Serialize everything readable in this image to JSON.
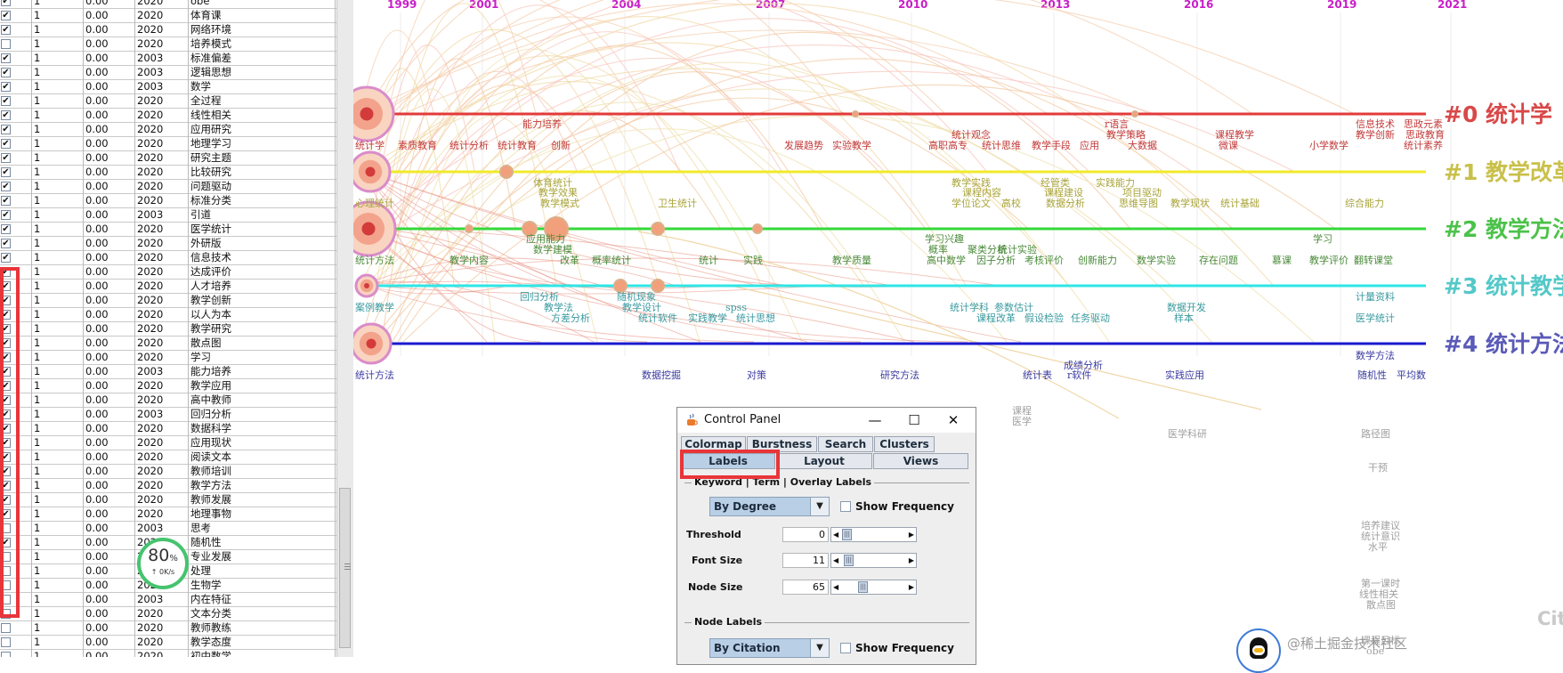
{
  "table": {
    "rows": [
      {
        "checked": true,
        "count": "1",
        "centrality": "0.00",
        "year": "2020",
        "keyword": "obe"
      },
      {
        "checked": true,
        "count": "1",
        "centrality": "0.00",
        "year": "2020",
        "keyword": "体育课"
      },
      {
        "checked": true,
        "count": "1",
        "centrality": "0.00",
        "year": "2020",
        "keyword": "网络环境"
      },
      {
        "checked": false,
        "count": "1",
        "centrality": "0.00",
        "year": "2020",
        "keyword": "培养模式"
      },
      {
        "checked": true,
        "count": "1",
        "centrality": "0.00",
        "year": "2003",
        "keyword": "标准偏差"
      },
      {
        "checked": true,
        "count": "1",
        "centrality": "0.00",
        "year": "2003",
        "keyword": "逻辑思想"
      },
      {
        "checked": true,
        "count": "1",
        "centrality": "0.00",
        "year": "2003",
        "keyword": "数学"
      },
      {
        "checked": true,
        "count": "1",
        "centrality": "0.00",
        "year": "2020",
        "keyword": "全过程"
      },
      {
        "checked": true,
        "count": "1",
        "centrality": "0.00",
        "year": "2020",
        "keyword": "线性相关"
      },
      {
        "checked": true,
        "count": "1",
        "centrality": "0.00",
        "year": "2020",
        "keyword": "应用研究"
      },
      {
        "checked": true,
        "count": "1",
        "centrality": "0.00",
        "year": "2020",
        "keyword": "地理学习"
      },
      {
        "checked": true,
        "count": "1",
        "centrality": "0.00",
        "year": "2020",
        "keyword": "研究主题"
      },
      {
        "checked": true,
        "count": "1",
        "centrality": "0.00",
        "year": "2020",
        "keyword": "比较研究"
      },
      {
        "checked": true,
        "count": "1",
        "centrality": "0.00",
        "year": "2020",
        "keyword": "问题驱动"
      },
      {
        "checked": true,
        "count": "1",
        "centrality": "0.00",
        "year": "2020",
        "keyword": "标准分类"
      },
      {
        "checked": true,
        "count": "1",
        "centrality": "0.00",
        "year": "2003",
        "keyword": "引道"
      },
      {
        "checked": true,
        "count": "1",
        "centrality": "0.00",
        "year": "2020",
        "keyword": "医学统计"
      },
      {
        "checked": true,
        "count": "1",
        "centrality": "0.00",
        "year": "2020",
        "keyword": "外研版"
      },
      {
        "checked": true,
        "count": "1",
        "centrality": "0.00",
        "year": "2020",
        "keyword": "信息技术"
      },
      {
        "checked": true,
        "count": "1",
        "centrality": "0.00",
        "year": "2020",
        "keyword": "达成评价"
      },
      {
        "checked": true,
        "count": "1",
        "centrality": "0.00",
        "year": "2020",
        "keyword": "人才培养"
      },
      {
        "checked": true,
        "count": "1",
        "centrality": "0.00",
        "year": "2020",
        "keyword": "教学创新"
      },
      {
        "checked": true,
        "count": "1",
        "centrality": "0.00",
        "year": "2020",
        "keyword": "以人为本"
      },
      {
        "checked": true,
        "count": "1",
        "centrality": "0.00",
        "year": "2020",
        "keyword": "教学研究"
      },
      {
        "checked": true,
        "count": "1",
        "centrality": "0.00",
        "year": "2020",
        "keyword": "散点图"
      },
      {
        "checked": true,
        "count": "1",
        "centrality": "0.00",
        "year": "2020",
        "keyword": "学习"
      },
      {
        "checked": true,
        "count": "1",
        "centrality": "0.00",
        "year": "2003",
        "keyword": "能力培养"
      },
      {
        "checked": true,
        "count": "1",
        "centrality": "0.00",
        "year": "2020",
        "keyword": "教学应用"
      },
      {
        "checked": true,
        "count": "1",
        "centrality": "0.00",
        "year": "2020",
        "keyword": "高中教师"
      },
      {
        "checked": true,
        "count": "1",
        "centrality": "0.00",
        "year": "2003",
        "keyword": "回归分析"
      },
      {
        "checked": true,
        "count": "1",
        "centrality": "0.00",
        "year": "2020",
        "keyword": "数据科学"
      },
      {
        "checked": true,
        "count": "1",
        "centrality": "0.00",
        "year": "2020",
        "keyword": "应用现状"
      },
      {
        "checked": true,
        "count": "1",
        "centrality": "0.00",
        "year": "2020",
        "keyword": "阅读文本"
      },
      {
        "checked": true,
        "count": "1",
        "centrality": "0.00",
        "year": "2020",
        "keyword": "教师培训"
      },
      {
        "checked": true,
        "count": "1",
        "centrality": "0.00",
        "year": "2020",
        "keyword": "教学方法"
      },
      {
        "checked": true,
        "count": "1",
        "centrality": "0.00",
        "year": "2020",
        "keyword": "教师发展"
      },
      {
        "checked": true,
        "count": "1",
        "centrality": "0.00",
        "year": "2020",
        "keyword": "地理事物"
      },
      {
        "checked": false,
        "count": "1",
        "centrality": "0.00",
        "year": "2003",
        "keyword": "思考"
      },
      {
        "checked": true,
        "count": "1",
        "centrality": "0.00",
        "year": "2020",
        "keyword": "随机性"
      },
      {
        "checked": false,
        "count": "1",
        "centrality": "0.00",
        "year": "2020",
        "keyword": "专业发展"
      },
      {
        "checked": false,
        "count": "1",
        "centrality": "0.00",
        "year": "2020",
        "keyword": "处理"
      },
      {
        "checked": false,
        "count": "1",
        "centrality": "0.00",
        "year": "2020",
        "keyword": "生物学"
      },
      {
        "checked": false,
        "count": "1",
        "centrality": "0.00",
        "year": "2003",
        "keyword": "内在特征"
      },
      {
        "checked": false,
        "count": "1",
        "centrality": "0.00",
        "year": "2020",
        "keyword": "文本分类"
      },
      {
        "checked": false,
        "count": "1",
        "centrality": "0.00",
        "year": "2020",
        "keyword": "教师教练"
      },
      {
        "checked": false,
        "count": "1",
        "centrality": "0.00",
        "year": "2020",
        "keyword": "教学态度"
      },
      {
        "checked": false,
        "count": "1",
        "centrality": "0.00",
        "year": "2020",
        "keyword": "初中数学"
      }
    ]
  },
  "net_meter": {
    "percent": "80",
    "percent_sign": "%",
    "speed": "↑ 0K/s"
  },
  "timeline": {
    "years": [
      "1999",
      "2001",
      "2004",
      "2007",
      "2010",
      "2013",
      "2016",
      "2019",
      "2021"
    ],
    "clusters": [
      {
        "id": "#0",
        "label": "#0 统计学",
        "color": "#e23a3a",
        "label_color": "#d94848"
      },
      {
        "id": "#1",
        "label": "#1 教学改革",
        "color": "#f0ea2a",
        "label_color": "#c9c04a"
      },
      {
        "id": "#2",
        "label": "#2 教学方法",
        "color": "#35d83a",
        "label_color": "#4cc24a"
      },
      {
        "id": "#3",
        "label": "#3 统计教学",
        "color": "#2fe6e6",
        "label_color": "#55c8c8"
      },
      {
        "id": "#4",
        "label": "#4 统计方法",
        "color": "#1a1ad0",
        "label_color": "#5a5ab8"
      }
    ],
    "keywords_c0": [
      "能力培养",
      "素质教育",
      "统计分析",
      "统计教育",
      "创新",
      "发展趋势",
      "实验教学",
      "统计观念",
      "高职高专",
      "统计思维",
      "教学手段",
      "r语言",
      "教学策略",
      "应用",
      "大数据",
      "课程教学",
      "微课",
      "小学数学",
      "信息技术",
      "教学创新",
      "思政元素",
      "思政教育",
      "统计素养",
      "统计学"
    ],
    "keywords_c1": [
      "体育统计",
      "教学效果",
      "教学模式",
      "卫生统计",
      "教学实践",
      "课程内容",
      "学位论文",
      "高校",
      "经管类",
      "课程建设",
      "数据分析",
      "实践能力",
      "项目驱动",
      "思维导图",
      "教学现状",
      "统计基础",
      "综合能力",
      "心理统计",
      "教学改革"
    ],
    "keywords_c2": [
      "应用能力",
      "数学建模",
      "改革",
      "概率统计",
      "统计",
      "实践",
      "教学内容",
      "教学质量",
      "学习兴趣",
      "概率",
      "聚类分析",
      "统计实验",
      "高中数学",
      "因子分析",
      "考核评价",
      "创新能力",
      "数学实验",
      "存在问题",
      "慕课",
      "学习",
      "教学评价",
      "翻转课堂",
      "统计方法"
    ],
    "keywords_c3": [
      "回归分析",
      "教学法",
      "方差分析",
      "随机现象",
      "教学设计",
      "统计软件",
      "实践教学",
      "spss",
      "统计思想",
      "统计学科",
      "参数估计",
      "课程改革",
      "假设检验",
      "任务驱动",
      "数据开发",
      "样本",
      "计量资料",
      "医学统计",
      "案例教学",
      "统计教学"
    ],
    "keywords_c4": [
      "数据挖掘",
      "对策",
      "研究方法",
      "统计表",
      "成绩分析",
      "r软件",
      "实践应用",
      "数学方法",
      "随机性",
      "平均数",
      "统计方法"
    ],
    "keywords_gray": [
      "课程",
      "医学",
      "医学科研",
      "路径图",
      "干预",
      "培养建议",
      "统计意识",
      "水平",
      "第一课时",
      "线性相关",
      "散点图",
      "课程目标",
      "obe"
    ]
  },
  "control_panel": {
    "title": "Control Panel",
    "minimize_glyph": "—",
    "maximize_glyph": "☐",
    "close_glyph": "✕",
    "tabs_row1": [
      "Colormap",
      "Burstness",
      "Search",
      "Clusters"
    ],
    "tabs_row2": [
      "Labels",
      "Layout",
      "Views"
    ],
    "selected_tab": "Labels",
    "section1": "Keyword | Term | Overlay Labels",
    "combo1": "By Degree",
    "show_frequency": "Show Frequency",
    "threshold_label": "Threshold",
    "threshold_value": "0",
    "font_size_label": "Font Size",
    "font_size_value": "11",
    "node_size_label": "Node Size",
    "node_size_value": "65",
    "section2": "Node Labels",
    "combo2": "By Citation",
    "show_frequency2": "Show Frequency"
  },
  "watermark": "@稀土掘金技术社区",
  "corner_text": "Cit"
}
